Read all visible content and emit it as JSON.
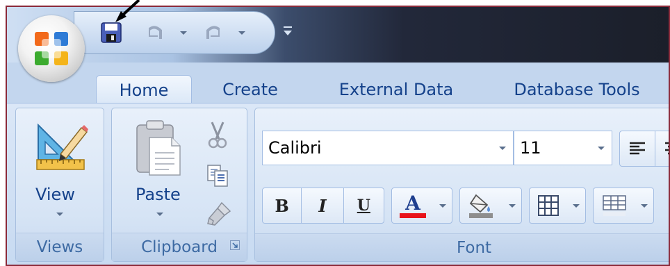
{
  "quick_access": {
    "save_icon": "save-icon",
    "undo_icon": "undo-icon",
    "redo_icon": "redo-icon",
    "customize_icon": "customize-qat-icon"
  },
  "tabs": [
    {
      "label": "Home",
      "active": true
    },
    {
      "label": "Create",
      "active": false
    },
    {
      "label": "External Data",
      "active": false
    },
    {
      "label": "Database Tools",
      "active": false
    }
  ],
  "groups": {
    "views": {
      "label": "Views",
      "view_label": "View"
    },
    "clipboard": {
      "label": "Clipboard",
      "paste_label": "Paste"
    },
    "font": {
      "label": "Font",
      "font_name": "Calibri",
      "font_size": "11",
      "bold": "B",
      "italic": "I",
      "underline": "U",
      "font_color_letter": "A"
    }
  },
  "colors": {
    "font_color_swatch": "#e8141b",
    "border": "#8b2a3a",
    "tab_text": "#15428b"
  }
}
